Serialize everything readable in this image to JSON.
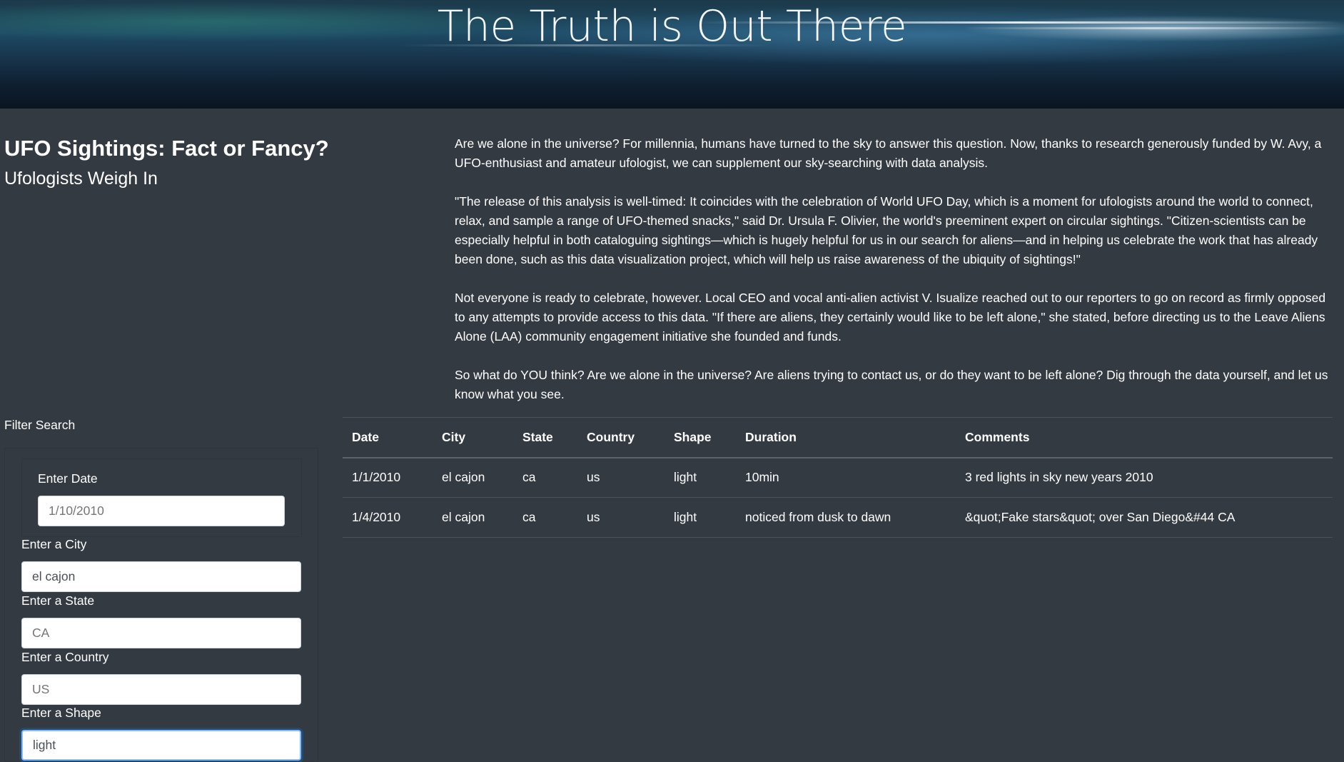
{
  "header": {
    "title": "The Truth is Out There"
  },
  "heading": {
    "main": "UFO Sightings: Fact or Fancy?",
    "sub": "Ufologists Weigh In"
  },
  "article": {
    "paragraphs": [
      "Are we alone in the universe? For millennia, humans have turned to the sky to answer this question. Now, thanks to research generously funded by W. Avy, a UFO-enthusiast and amateur ufologist, we can supplement our sky-searching with data analysis.",
      "\"The release of this analysis is well-timed: It coincides with the celebration of World UFO Day, which is a moment for ufologists around the world to connect, relax, and sample a range of UFO-themed snacks,\" said Dr. Ursula F. Olivier, the world's preeminent expert on circular sightings. \"Citizen-scientists can be especially helpful in both cataloguing sightings—which is hugely helpful for us in our search for aliens—and in helping us celebrate the work that has already been done, such as this data visualization project, which will help us raise awareness of the ubiquity of sightings!\"",
      "Not everyone is ready to celebrate, however. Local CEO and vocal anti-alien activist V. Isualize reached out to our reporters to go on record as firmly opposed to any attempts to provide access to this data. \"If there are aliens, they certainly would like to be left alone,\" she stated, before directing us to the Leave Aliens Alone (LAA) community engagement initiative she founded and funds.",
      "So what do YOU think? Are we alone in the universe? Are aliens trying to contact us, or do they want to be left alone? Dig through the data yourself, and let us know what you see."
    ]
  },
  "filters": {
    "title": "Filter Search",
    "date": {
      "label": "Enter Date",
      "placeholder": "1/10/2010",
      "value": ""
    },
    "city": {
      "label": "Enter a City",
      "placeholder": "",
      "value": "el cajon"
    },
    "state": {
      "label": "Enter a State",
      "placeholder": "CA",
      "value": ""
    },
    "country": {
      "label": "Enter a Country",
      "placeholder": "US",
      "value": ""
    },
    "shape": {
      "label": "Enter a Shape",
      "placeholder": "",
      "value": "light"
    }
  },
  "table": {
    "headers": [
      "Date",
      "City",
      "State",
      "Country",
      "Shape",
      "Duration",
      "Comments"
    ],
    "rows": [
      [
        "1/1/2010",
        "el cajon",
        "ca",
        "us",
        "light",
        "10min",
        "3 red lights in sky new years 2010"
      ],
      [
        "1/4/2010",
        "el cajon",
        "ca",
        "us",
        "light",
        "noticed from dusk to dawn",
        "&quot;Fake stars&quot; over San Diego&#44 CA"
      ]
    ]
  }
}
